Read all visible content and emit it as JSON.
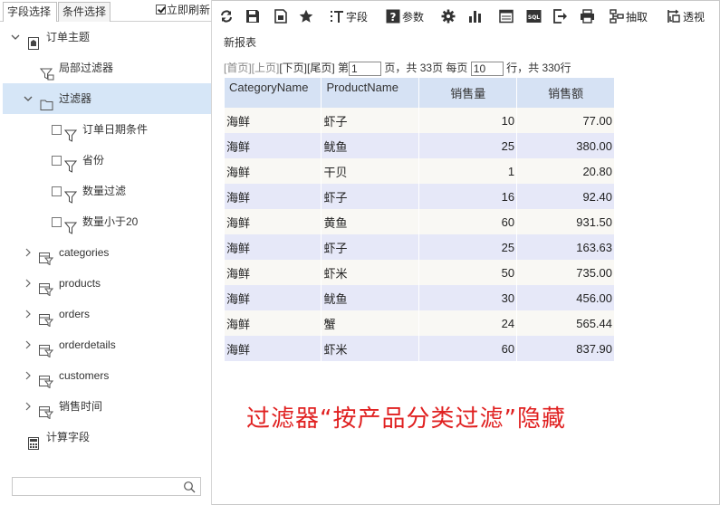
{
  "left_panel": {
    "tabs": [
      {
        "label": "字段选择"
      },
      {
        "label": "条件选择"
      }
    ],
    "refresh_label": "立即刷新",
    "tree": [
      {
        "label": "订单主题"
      },
      {
        "label": "局部过滤器"
      },
      {
        "label": "过滤器"
      },
      {
        "label": "订单日期条件"
      },
      {
        "label": "省份"
      },
      {
        "label": "数量过滤"
      },
      {
        "label": "数量小于20"
      },
      {
        "label": "categories"
      },
      {
        "label": "products"
      },
      {
        "label": "orders"
      },
      {
        "label": "orderdetails"
      },
      {
        "label": "customers"
      },
      {
        "label": "销售时间"
      },
      {
        "label": "计算字段"
      }
    ],
    "search_placeholder": ""
  },
  "toolbar": {
    "field_label": "字段",
    "param_label": "参数",
    "extract_label": "抽取",
    "pivot_label": "透视"
  },
  "report": {
    "title": "新报表",
    "pager": {
      "first": "[首页]",
      "prev": "[上页]",
      "next": "[下页]",
      "last": "[尾页]",
      "page_prefix": "第",
      "page_value": "1",
      "page_suffix": "页，共 33页 每页",
      "per_page_value": "10",
      "rows_suffix": "行，共 330行"
    },
    "columns": [
      "CategoryName",
      "ProductName",
      "销售量",
      "销售额"
    ],
    "rows": [
      [
        "海鲜",
        "虾子",
        "10",
        "77.00"
      ],
      [
        "海鲜",
        "鱿鱼",
        "25",
        "380.00"
      ],
      [
        "海鲜",
        "干贝",
        "1",
        "20.80"
      ],
      [
        "海鲜",
        "虾子",
        "16",
        "92.40"
      ],
      [
        "海鲜",
        "黄鱼",
        "60",
        "931.50"
      ],
      [
        "海鲜",
        "虾子",
        "25",
        "163.63"
      ],
      [
        "海鲜",
        "虾米",
        "50",
        "735.00"
      ],
      [
        "海鲜",
        "鱿鱼",
        "30",
        "456.00"
      ],
      [
        "海鲜",
        "蟹",
        "24",
        "565.44"
      ],
      [
        "海鲜",
        "虾米",
        "60",
        "837.90"
      ]
    ]
  },
  "annotation": "过滤器“按产品分类过滤”隐藏"
}
